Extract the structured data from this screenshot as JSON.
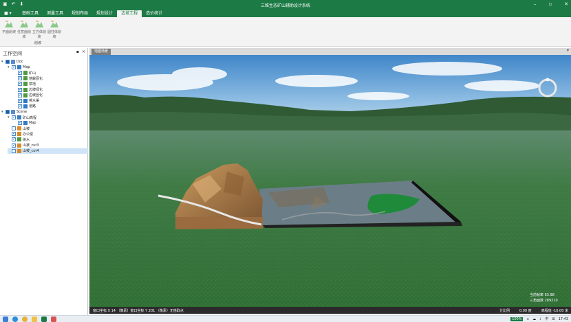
{
  "window": {
    "title": "三维生态矿山辅助设计系统",
    "quick_access_icons": [
      "save-icon",
      "undo-icon",
      "dropdown-icon"
    ],
    "controls": [
      "minimize-icon",
      "restore-icon",
      "close-icon"
    ]
  },
  "menu": {
    "app_button": "■ ▾",
    "tabs": [
      {
        "label": "基础工具",
        "active": false
      },
      {
        "label": "测量工具",
        "active": false
      },
      {
        "label": "规划布局",
        "active": false
      },
      {
        "label": "规划设计",
        "active": false
      },
      {
        "label": "边坡工程",
        "active": true
      },
      {
        "label": "造价统计",
        "active": false
      }
    ]
  },
  "ribbon": {
    "buttons": [
      {
        "label": "平面削坡",
        "icon": "mountain-cut-icon"
      },
      {
        "label": "任意面削坡",
        "icon": "mountain-cut-icon"
      },
      {
        "label": "立方体削坡",
        "icon": "mountain-cut-icon"
      },
      {
        "label": "圆柱体削坡",
        "icon": "mountain-cut-icon"
      }
    ],
    "group_label": "削坡"
  },
  "workspace": {
    "title": "工作空间",
    "pin": "▪",
    "close": "×",
    "tree": [
      {
        "label": "Doc",
        "level": 0,
        "expand": "▾",
        "check": "part",
        "icon": "doc"
      },
      {
        "label": "Map",
        "level": 1,
        "expand": "▾",
        "check": "on",
        "icon": "map"
      },
      {
        "label": "矿山",
        "level": 2,
        "expand": "",
        "check": "on",
        "icon": "layer"
      },
      {
        "label": "地貌固化",
        "level": 2,
        "expand": "",
        "check": "on",
        "icon": "layer"
      },
      {
        "label": "草地",
        "level": 2,
        "expand": "",
        "check": "on",
        "icon": "layer"
      },
      {
        "label": "边坡绿化",
        "level": 2,
        "expand": "",
        "check": "on",
        "icon": "layer"
      },
      {
        "label": "边坡固化",
        "level": 2,
        "expand": "",
        "check": "on",
        "icon": "layer"
      },
      {
        "label": "排水渠",
        "level": 2,
        "expand": "",
        "check": "on",
        "icon": "line"
      },
      {
        "label": "道路",
        "level": 2,
        "expand": "",
        "check": "on",
        "icon": "line"
      },
      {
        "label": "Scene",
        "level": 0,
        "expand": "▾",
        "check": "part",
        "icon": "scene"
      },
      {
        "label": "矿山高程",
        "level": 1,
        "expand": "▾",
        "check": "on",
        "icon": "map"
      },
      {
        "label": "Map",
        "level": 2,
        "expand": "",
        "check": "on",
        "icon": "map"
      },
      {
        "label": "山被",
        "level": 1,
        "expand": "",
        "check": "off",
        "icon": "model"
      },
      {
        "label": "办公楼",
        "level": 1,
        "expand": "",
        "check": "on",
        "icon": "model"
      },
      {
        "label": "树木",
        "level": 1,
        "expand": "",
        "check": "on",
        "icon": "layer"
      },
      {
        "label": "山被_cut3",
        "level": 1,
        "expand": "",
        "check": "on",
        "icon": "model"
      },
      {
        "label": "山被_cut4",
        "level": 1,
        "expand": "",
        "check": "off",
        "icon": "model",
        "selected": true
      }
    ]
  },
  "view": {
    "tab_label": "地图场景",
    "dropdown": "▾"
  },
  "status": {
    "left": "窗口坐标 X 14 （像素）窗口坐标 Y 201 （像素）无拾取点",
    "scale_label": "分比例",
    "v1": "0.00 度",
    "v2": "高程值 -10.00 米"
  },
  "scene_stats": {
    "fps": "当前帧率  63.98",
    "triangles": "三角面数  289210"
  },
  "taskbar": {
    "zoom": "100%",
    "lang": "中",
    "time": "17:43",
    "tray": [
      "∧",
      "☁",
      "♪",
      "⊞"
    ]
  },
  "colors": {
    "brand": "#1c7a45",
    "grass": "#3d7a40",
    "green_area": "#1f8a3a"
  }
}
